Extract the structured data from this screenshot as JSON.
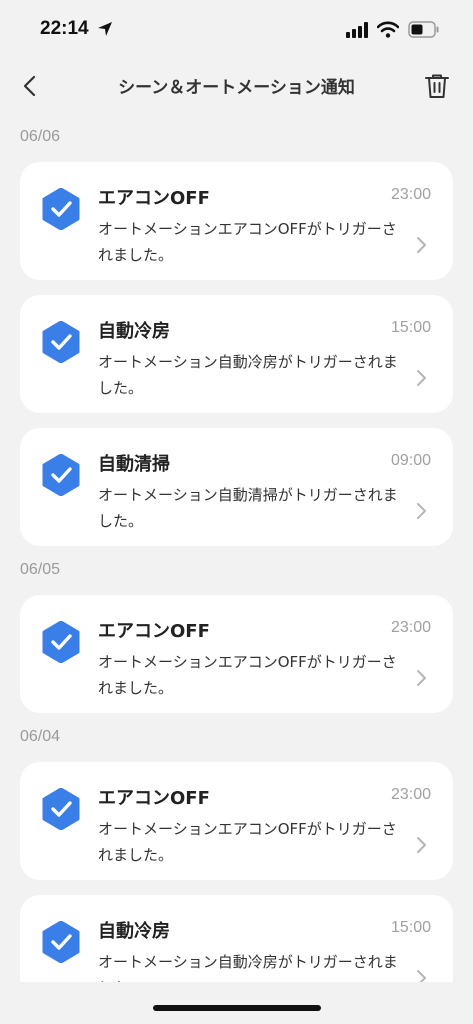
{
  "status_bar": {
    "time": "22:14",
    "icons": [
      "location-arrow-icon",
      "cellular-signal-icon",
      "wifi-icon",
      "battery-icon"
    ]
  },
  "nav": {
    "title": "シーン＆オートメーション通知",
    "back_icon": "chevron-left-icon",
    "delete_icon": "trash-icon"
  },
  "colors": {
    "accent": "#3a7ee8",
    "background": "#f2f2f2",
    "card": "#ffffff",
    "muted_text": "#a0a0a0"
  },
  "groups": [
    {
      "date": "06/06",
      "items": [
        {
          "title": "エアコンOFF",
          "time": "23:00",
          "message": "オートメーションエアコンOFFがトリガーされました。"
        },
        {
          "title": "自動冷房",
          "time": "15:00",
          "message": "オートメーション自動冷房がトリガーされました。"
        },
        {
          "title": "自動清掃",
          "time": "09:00",
          "message": "オートメーション自動清掃がトリガーされました。"
        }
      ]
    },
    {
      "date": "06/05",
      "items": [
        {
          "title": "エアコンOFF",
          "time": "23:00",
          "message": "オートメーションエアコンOFFがトリガーされました。"
        }
      ]
    },
    {
      "date": "06/04",
      "items": [
        {
          "title": "エアコンOFF",
          "time": "23:00",
          "message": "オートメーションエアコンOFFがトリガーされました。"
        },
        {
          "title": "自動冷房",
          "time": "15:00",
          "message": "オートメーション自動冷房がトリガーされました。"
        }
      ]
    }
  ]
}
